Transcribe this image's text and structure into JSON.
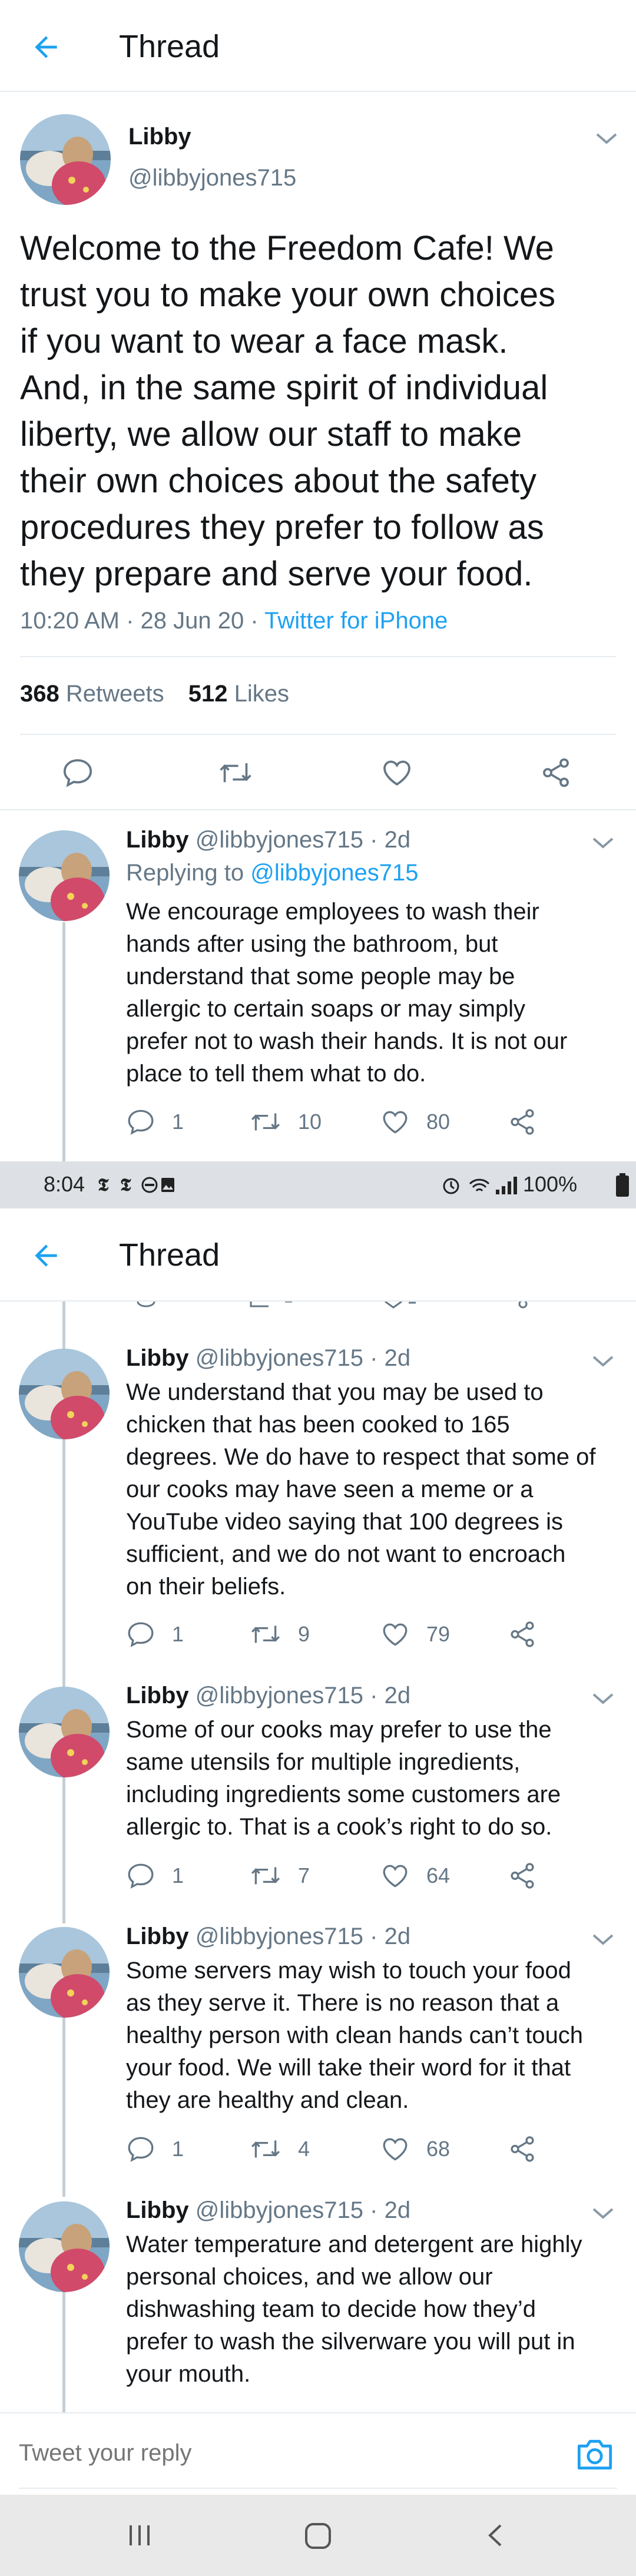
{
  "header": {
    "title": "Thread"
  },
  "main_tweet": {
    "name": "Libby",
    "handle": "@libbyjones715",
    "text_lines": [
      "Welcome to the Freedom Cafe! We",
      "trust you to make your own choices",
      "if you want to wear a face mask.",
      "And, in the same spirit of individual",
      "liberty, we allow our staff to make",
      "their own choices about the safety",
      "procedures they prefer to follow as",
      "they prepare and serve your food."
    ],
    "timestamp": "10:20 AM · 28 Jun 20 · ",
    "source": "Twitter for iPhone",
    "retweets_count": "368",
    "retweets_label": " Retweets",
    "likes_count": "512",
    "likes_label": " Likes"
  },
  "replies_top": [
    {
      "name": "Libby",
      "handle_meta": "@libbyjones715 · 2d",
      "replying_prefix": "Replying to ",
      "replying_handle": "@libbyjones715",
      "text_lines": [
        "We encourage employees to wash their",
        "hands after using the bathroom, but",
        "understand that some people may be",
        "allergic to certain soaps or may simply",
        "prefer not to wash their hands. It is not our",
        "place to tell them what to do."
      ],
      "replies": "1",
      "retweets": "10",
      "likes": "80"
    }
  ],
  "status_bar": {
    "time": "8:04",
    "battery": "100%"
  },
  "replies_bottom": [
    {
      "name": "Libby",
      "handle_meta": "@libbyjones715 · 2d",
      "text_lines": [
        "We understand that you may be used to",
        "chicken that has been cooked to 165",
        "degrees. We do have to respect that some of",
        "our cooks may have seen a meme or a",
        "YouTube video saying that 100 degrees is",
        "sufficient, and we do not want to encroach",
        "on their beliefs."
      ],
      "replies": "1",
      "retweets": "9",
      "likes": "79"
    },
    {
      "name": "Libby",
      "handle_meta": "@libbyjones715 · 2d",
      "text_lines": [
        "Some of our cooks may prefer to use the",
        "same utensils for multiple ingredients,",
        "including ingredients some customers are",
        "allergic to. That is a cook’s right to do so."
      ],
      "replies": "1",
      "retweets": "7",
      "likes": "64"
    },
    {
      "name": "Libby",
      "handle_meta": "@libbyjones715 · 2d",
      "text_lines": [
        "Some servers may wish to touch your food",
        "as they serve it. There is no reason that a",
        "healthy person with clean hands can’t touch",
        "your food. We will take their word for it that",
        "they are healthy and clean."
      ],
      "replies": "1",
      "retweets": "4",
      "likes": "68"
    },
    {
      "name": "Libby",
      "handle_meta": "@libbyjones715 · 2d",
      "text_lines": [
        "Water temperature and detergent are highly",
        "personal choices, and we allow our",
        "dishwashing team to decide how they’d",
        "prefer to wash the silverware you will put in",
        "your mouth."
      ]
    }
  ],
  "reply_bar": {
    "placeholder": "Tweet your reply"
  },
  "colors": {
    "accent": "#1da1f2",
    "muted": "#657786",
    "text": "#14171a",
    "divider": "#e6ecf0"
  }
}
